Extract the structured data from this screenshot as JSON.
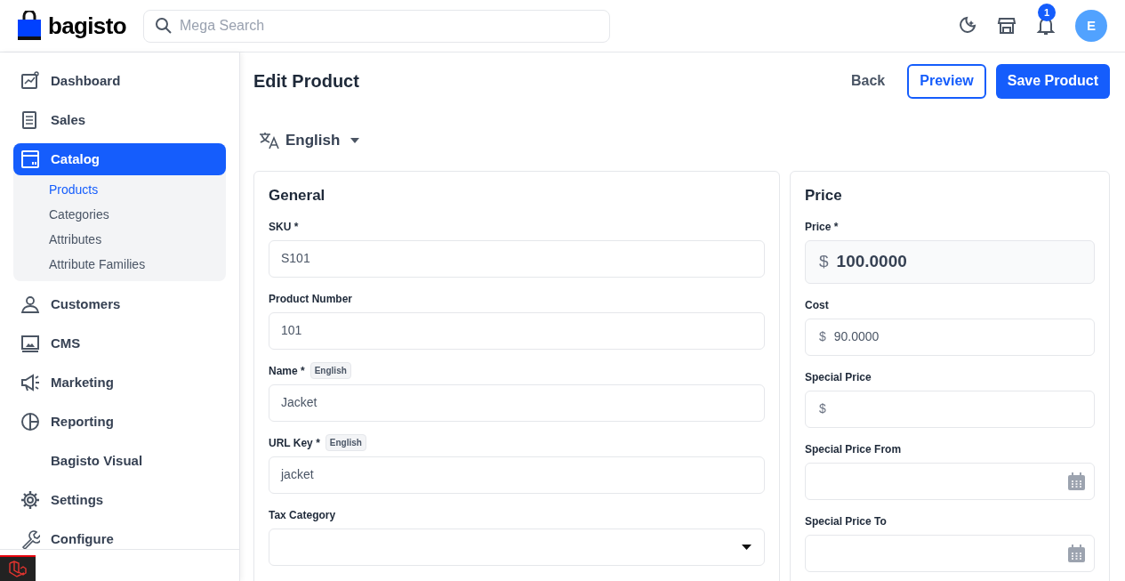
{
  "header": {
    "logo_text": "bagisto",
    "search": {
      "placeholder": "Mega Search"
    },
    "notification_count": "1",
    "avatar_initial": "E"
  },
  "sidebar": {
    "items": [
      {
        "label": "Dashboard",
        "selected": false
      },
      {
        "label": "Sales",
        "selected": false
      },
      {
        "label": "Catalog",
        "selected": true,
        "expanded": true,
        "children": [
          {
            "label": "Products",
            "selected": true
          },
          {
            "label": "Categories",
            "selected": false
          },
          {
            "label": "Attributes",
            "selected": false
          },
          {
            "label": "Attribute Families",
            "selected": false
          }
        ]
      },
      {
        "label": "Customers",
        "selected": false
      },
      {
        "label": "CMS",
        "selected": false
      },
      {
        "label": "Marketing",
        "selected": false
      },
      {
        "label": "Reporting",
        "selected": false
      },
      {
        "label": "Bagisto Visual",
        "selected": false
      },
      {
        "label": "Settings",
        "selected": false
      },
      {
        "label": "Configure",
        "selected": false
      }
    ]
  },
  "page": {
    "title": "Edit Product",
    "buttons": [
      {
        "label": "Back",
        "kind": "plain"
      },
      {
        "label": "Preview",
        "kind": "outline"
      },
      {
        "label": "Save Product",
        "kind": "primary"
      }
    ],
    "locale": "English"
  },
  "cards": [
    {
      "title": "General",
      "fields": [
        {
          "label": "SKU *",
          "kind": "text",
          "value": "S101"
        },
        {
          "label": "Product Number",
          "kind": "text",
          "value": "101"
        },
        {
          "label": "Name *",
          "badge": "English",
          "kind": "text",
          "value": "Jacket"
        },
        {
          "label": "URL Key *",
          "badge": "English",
          "kind": "text",
          "value": "jacket"
        },
        {
          "label": "Tax Category",
          "kind": "select"
        }
      ]
    },
    {
      "title": "Price",
      "fields": [
        {
          "label": "Price *",
          "kind": "price_large",
          "prefix": "$",
          "value": "100.0000"
        },
        {
          "label": "Cost",
          "kind": "price",
          "prefix": "$",
          "value": "90.0000"
        },
        {
          "label": "Special Price",
          "kind": "price",
          "prefix": "$"
        },
        {
          "label": "Special Price From",
          "kind": "date"
        },
        {
          "label": "Special Price To",
          "kind": "date"
        }
      ]
    }
  ]
}
